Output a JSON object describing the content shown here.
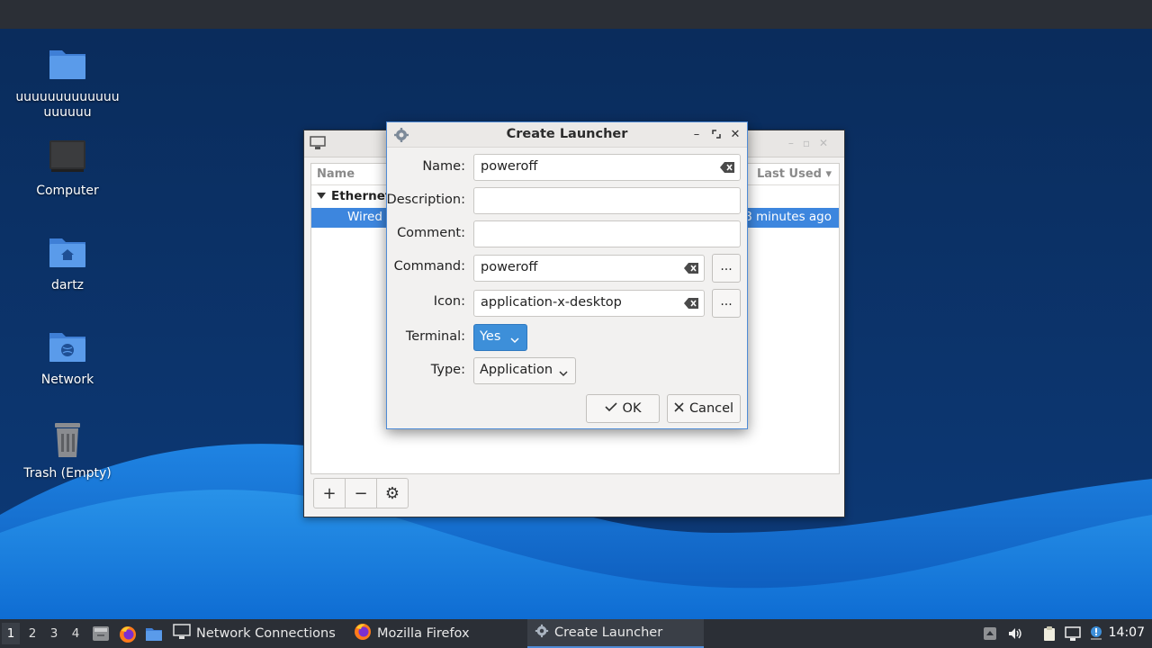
{
  "desktop": {
    "icons": [
      {
        "label": "uuuuuuuuuuuuuuuuuuu",
        "icon": "folder-icon"
      },
      {
        "label": "Computer",
        "icon": "computer-icon"
      },
      {
        "label": "dartz",
        "icon": "home-folder-icon"
      },
      {
        "label": "Network",
        "icon": "network-folder-icon"
      },
      {
        "label": "Trash (Empty)",
        "icon": "trash-icon"
      }
    ]
  },
  "network_window": {
    "columns": {
      "name": "Name",
      "last_used": "Last Used"
    },
    "group": "Ethernet",
    "connection": {
      "name": "Wired",
      "last_used": "8 minutes ago"
    },
    "toolbar": {
      "add": "+",
      "remove": "−",
      "settings": "gear-icon"
    }
  },
  "dialog": {
    "title": "Create Launcher",
    "fields": {
      "name_label": "Name:",
      "name_value": "poweroff",
      "description_label": "Description:",
      "description_value": "",
      "comment_label": "Comment:",
      "comment_value": "",
      "command_label": "Command:",
      "command_value": "poweroff",
      "icon_label": "Icon:",
      "icon_value": "application-x-desktop",
      "browse_label": "...",
      "terminal_label": "Terminal:",
      "terminal_value": "Yes",
      "type_label": "Type:",
      "type_value": "Application"
    },
    "buttons": {
      "ok": "OK",
      "cancel": "Cancel"
    }
  },
  "taskbar": {
    "workspaces": [
      "1",
      "2",
      "3",
      "4"
    ],
    "tasks": [
      {
        "label": "Network Connections"
      },
      {
        "label": "Mozilla Firefox"
      },
      {
        "label": "Create Launcher"
      }
    ],
    "clock": "14:07"
  },
  "colors": {
    "accent": "#3d86de",
    "wallpaper_dark": "#0b2a52",
    "wallpaper_light": "#1f8fe8",
    "panel": "#2b2f36"
  }
}
